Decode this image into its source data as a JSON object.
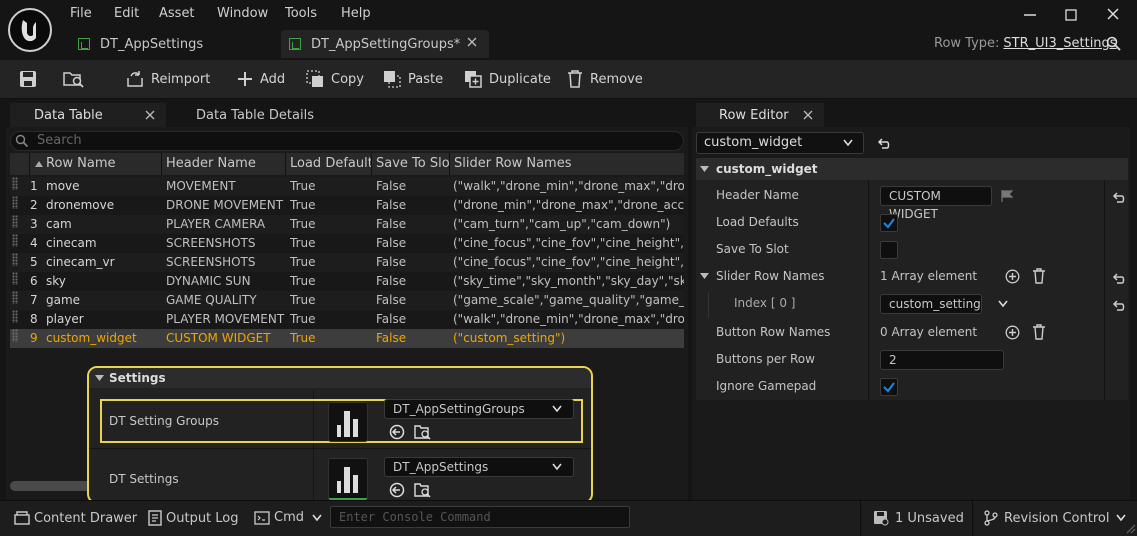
{
  "menu": [
    "File",
    "Edit",
    "Asset",
    "Window",
    "Tools",
    "Help"
  ],
  "tabs": [
    {
      "label": "DT_AppSettings"
    },
    {
      "label": "DT_AppSettingGroups*"
    }
  ],
  "row_type": {
    "label": "Row Type:",
    "value": "STR_UI3_Settings"
  },
  "toolbar": {
    "reimport": "Reimport",
    "add": "Add",
    "copy": "Copy",
    "paste": "Paste",
    "duplicate": "Duplicate",
    "remove": "Remove"
  },
  "panels": {
    "data_table": "Data Table",
    "data_table_details": "Data Table Details",
    "row_editor": "Row Editor"
  },
  "search": {
    "placeholder": "Search"
  },
  "columns": [
    "Row Name",
    "Header Name",
    "Load Defaults",
    "Save To Slot",
    "Slider Row Names"
  ],
  "rows": [
    {
      "idx": "1",
      "name": "move",
      "header": "MOVEMENT",
      "load": "True",
      "save": "False",
      "slider": "(\"walk\",\"drone_min\",\"drone_max\",\"drone_acc"
    },
    {
      "idx": "2",
      "name": "dronemove",
      "header": "DRONE MOVEMENT",
      "load": "True",
      "save": "False",
      "slider": "(\"drone_min\",\"drone_max\",\"drone_acc\",\"dron"
    },
    {
      "idx": "3",
      "name": "cam",
      "header": "PLAYER CAMERA",
      "load": "True",
      "save": "False",
      "slider": "(\"cam_turn\",\"cam_up\",\"cam_down\")"
    },
    {
      "idx": "4",
      "name": "cinecam",
      "header": "SCREENSHOTS",
      "load": "True",
      "save": "False",
      "slider": "(\"cine_focus\",\"cine_fov\",\"cine_height\",\"cine_a"
    },
    {
      "idx": "5",
      "name": "cinecam_vr",
      "header": "SCREENSHOTS",
      "load": "True",
      "save": "False",
      "slider": "(\"cine_focus\",\"cine_fov\",\"cine_height\",\"cine_a"
    },
    {
      "idx": "6",
      "name": "sky",
      "header": "DYNAMIC SUN",
      "load": "True",
      "save": "False",
      "slider": "(\"sky_time\",\"sky_month\",\"sky_day\",\"sky_spee"
    },
    {
      "idx": "7",
      "name": "game",
      "header": "GAME QUALITY",
      "load": "True",
      "save": "False",
      "slider": "(\"game_scale\",\"game_quality\",\"game_aa\",\"g"
    },
    {
      "idx": "8",
      "name": "player",
      "header": "PLAYER MOVEMENT",
      "load": "True",
      "save": "False",
      "slider": "(\"walk\",\"drone_min\",\"drone_max\",\"drone_acc"
    },
    {
      "idx": "9",
      "name": "custom_widget",
      "header": "CUSTOM WIDGET",
      "load": "True",
      "save": "False",
      "slider": "(\"custom_setting\")"
    }
  ],
  "settings": {
    "title": "Settings",
    "groups_label": "DT Setting Groups",
    "groups_value": "DT_AppSettingGroups",
    "settings_label": "DT Settings",
    "settings_value": "DT_AppSettings"
  },
  "row_editor": {
    "selected_row": "custom_widget",
    "section": "custom_widget",
    "header_name_label": "Header Name",
    "header_name_value": "CUSTOM WIDGET",
    "load_defaults_label": "Load Defaults",
    "load_defaults": true,
    "save_to_slot_label": "Save To Slot",
    "save_to_slot": false,
    "slider_row_names_label": "Slider Row Names",
    "slider_row_names_count": "1 Array element",
    "index_label": "Index [ 0 ]",
    "index_value": "custom_setting",
    "button_row_names_label": "Button Row Names",
    "button_row_names_count": "0 Array element",
    "buttons_per_row_label": "Buttons per Row",
    "buttons_per_row_value": "2",
    "ignore_gamepad_label": "Ignore Gamepad",
    "ignore_gamepad": true
  },
  "status": {
    "content_drawer": "Content Drawer",
    "output_log": "Output Log",
    "cmd": "Cmd",
    "console_placeholder": "Enter Console Command",
    "unsaved": "1 Unsaved",
    "revision_control": "Revision Control"
  },
  "colors": {
    "highlight": "#e8d44d",
    "selected_row_text": "#f0a500",
    "checkbox": "#1e88e5",
    "asset_icon": "#43a047"
  }
}
